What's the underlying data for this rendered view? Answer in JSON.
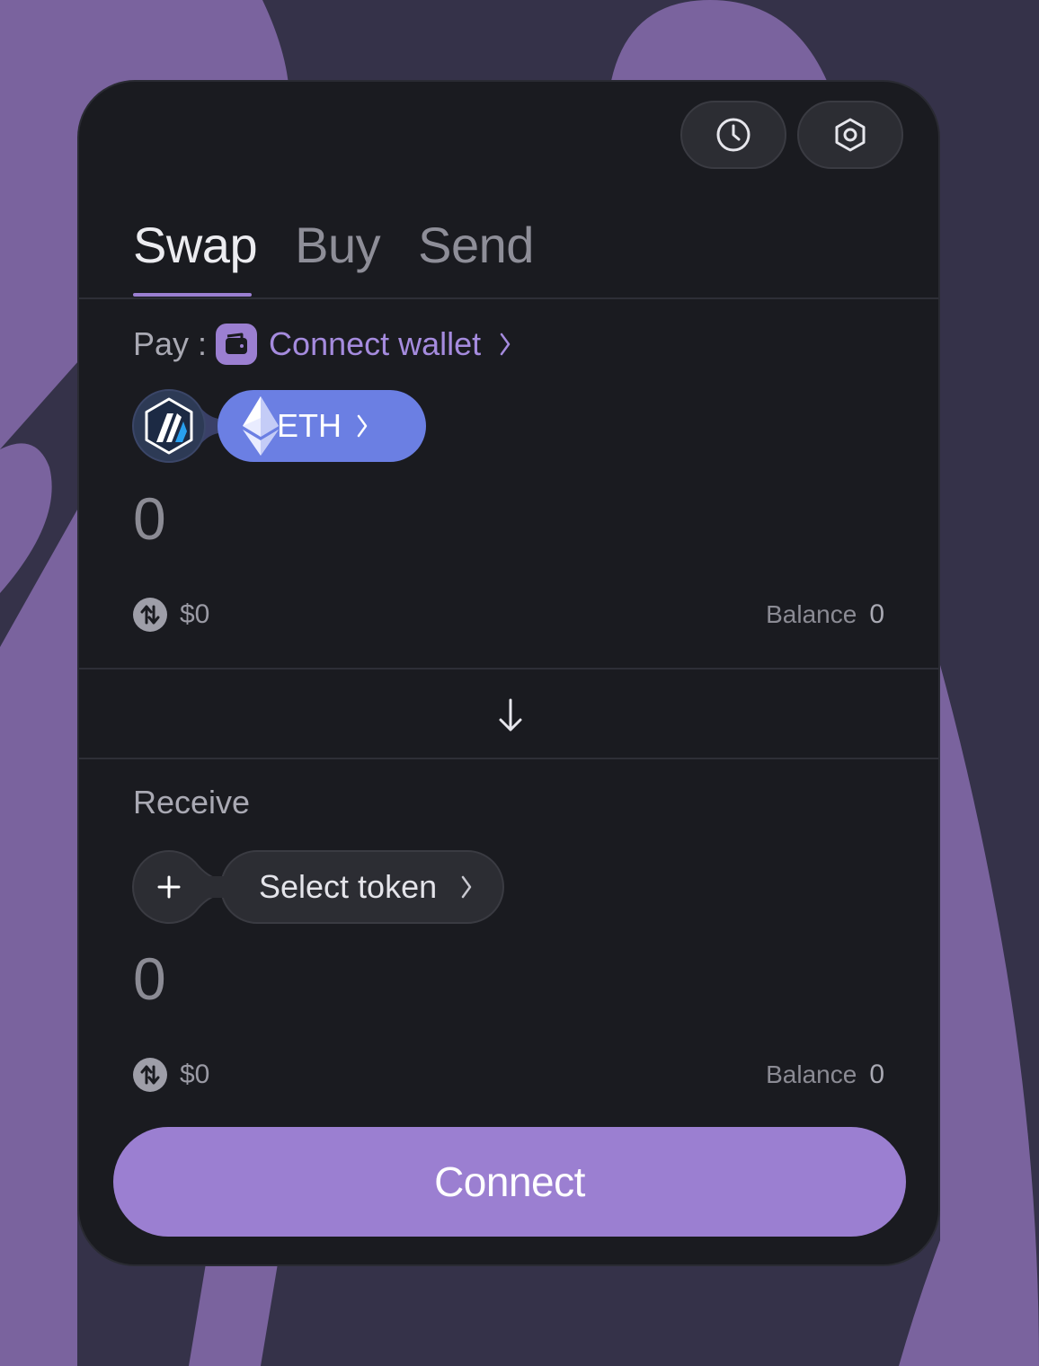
{
  "tabs": [
    {
      "label": "Swap",
      "active": true
    },
    {
      "label": "Buy",
      "active": false
    },
    {
      "label": "Send",
      "active": false
    }
  ],
  "toolbar": {
    "history_icon": "clock-icon",
    "settings_icon": "gear-icon"
  },
  "pay": {
    "label": "Pay :",
    "wallet_link": "Connect wallet",
    "chain_icon": "arbitrum-icon",
    "token_icon": "ethereum-icon",
    "token_symbol": "ETH",
    "amount": "0",
    "fiat_value": "$0",
    "balance_label": "Balance",
    "balance_value": "0"
  },
  "receive": {
    "label": "Receive",
    "select_label": "Select token",
    "amount": "0",
    "fiat_value": "$0",
    "balance_label": "Balance",
    "balance_value": "0"
  },
  "connect_button": "Connect",
  "colors": {
    "accent": "#9b7fd1",
    "eth_pill": "#6b7fe3",
    "card": "#1a1b20",
    "background": "#353249",
    "blob": "#7a639e"
  }
}
